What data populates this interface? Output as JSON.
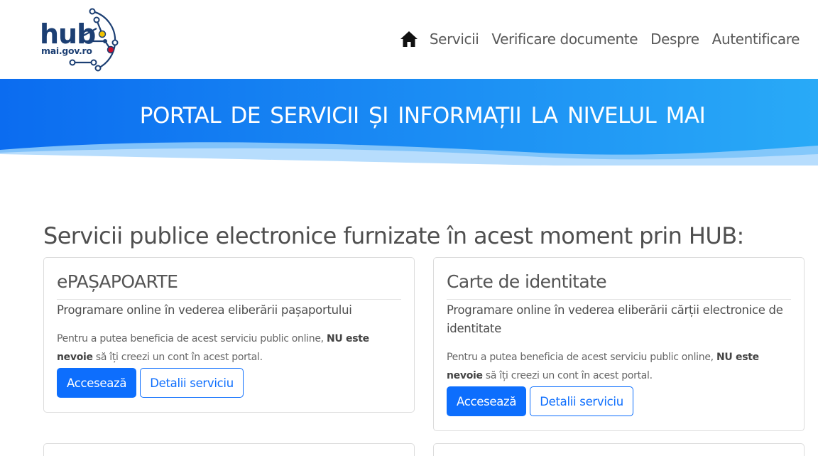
{
  "logo": {
    "text": "hub",
    "domain": "mai.gov.ro"
  },
  "nav": {
    "home_icon": "home-icon",
    "items": [
      "Servicii",
      "Verificare documente",
      "Despre",
      "Autentificare"
    ]
  },
  "banner": {
    "title": "PORTAL  DE SERVICII ȘI  INFORMAȚII  LA  NIVELUL  MAI"
  },
  "main": {
    "section_title": "Servicii publice electronice furnizate în acest moment prin  HUB:",
    "cards": [
      {
        "title": "ePAȘAPOARTE",
        "subtitle": "Programare online în vederea eliberării pașaportului",
        "note_before": "Pentru a putea beneficia de acest serviciu public online, ",
        "note_bold": "NU este nevoie",
        "note_after": " să îți creezi un cont în acest portal.",
        "primary_label": "Accesează",
        "secondary_label": "Detalii serviciu"
      },
      {
        "title": "Carte de identitate",
        "subtitle": "Programare online în vederea eliberării cărții electronice de identitate",
        "note_before": "Pentru a putea beneficia de acest serviciu public online, ",
        "note_bold": "NU este nevoie",
        "note_after": " să îți creezi un cont în acest portal.",
        "primary_label": "Accesează",
        "secondary_label": "Detalii serviciu"
      }
    ]
  },
  "colors": {
    "accent": "#0d6efd",
    "banner_start": "#0b6cf0",
    "banner_end": "#29aaf7",
    "logo": "#1c3f73"
  }
}
